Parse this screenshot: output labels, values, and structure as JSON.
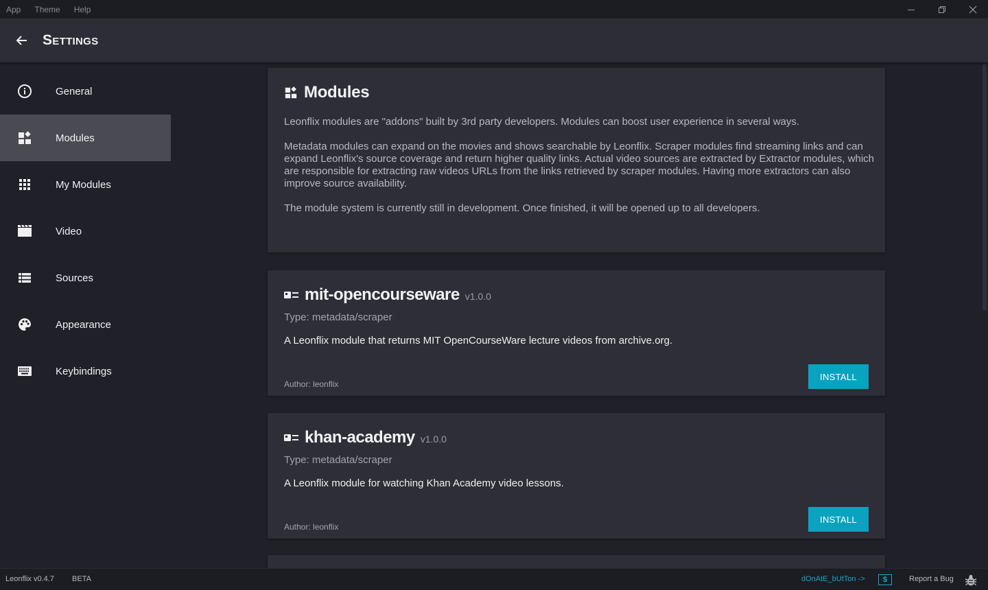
{
  "menu": [
    "App",
    "Theme",
    "Help"
  ],
  "header": {
    "title": "Settings"
  },
  "sidebar": {
    "items": [
      {
        "label": "General",
        "icon": "info-icon",
        "active": false
      },
      {
        "label": "Modules",
        "icon": "modules-icon",
        "active": true
      },
      {
        "label": "My Modules",
        "icon": "grid-icon",
        "active": false
      },
      {
        "label": "Video",
        "icon": "film-icon",
        "active": false
      },
      {
        "label": "Sources",
        "icon": "list-icon",
        "active": false
      },
      {
        "label": "Appearance",
        "icon": "palette-icon",
        "active": false
      },
      {
        "label": "Keybindings",
        "icon": "keyboard-icon",
        "active": false
      }
    ]
  },
  "intro": {
    "title": "Modules",
    "p1": "Leonflix modules are \"addons\" built by 3rd party developers. Modules can boost user experience in several ways.",
    "p2": "Metadata modules can expand on the movies and shows searchable by Leonflix. Scraper modules find streaming links and can expand Leonflix's source coverage and return higher quality links. Actual video sources are extracted by Extractor modules, which are responsible for extracting raw videos URLs from the links retrieved by scraper modules. Having more extractors can also improve source availability.",
    "p3": "The module system is currently still in development. Once finished, it will be opened up to all developers."
  },
  "modules": [
    {
      "name": "mit-opencourseware",
      "version": "v1.0.0",
      "type": "Type: metadata/scraper",
      "description": "A Leonflix module that returns MIT OpenCourseWare lecture videos from archive.org.",
      "author": "Author: leonflix",
      "button": "INSTALL"
    },
    {
      "name": "khan-academy",
      "version": "v1.0.0",
      "type": "Type: metadata/scraper",
      "description": "A Leonflix module for watching Khan Academy video lessons.",
      "author": "Author: leonflix",
      "button": "INSTALL"
    }
  ],
  "footer": {
    "version": "Leonflix v0.4.7",
    "channel": "BETA",
    "donate": "dOnAtE_bUtTon ->",
    "donate_symbol": "$",
    "report": "Report a Bug"
  },
  "colors": {
    "accent": "#0aa3bf",
    "background": "#1f2028",
    "card": "#2d2e38",
    "active_nav": "#4a4b52"
  }
}
